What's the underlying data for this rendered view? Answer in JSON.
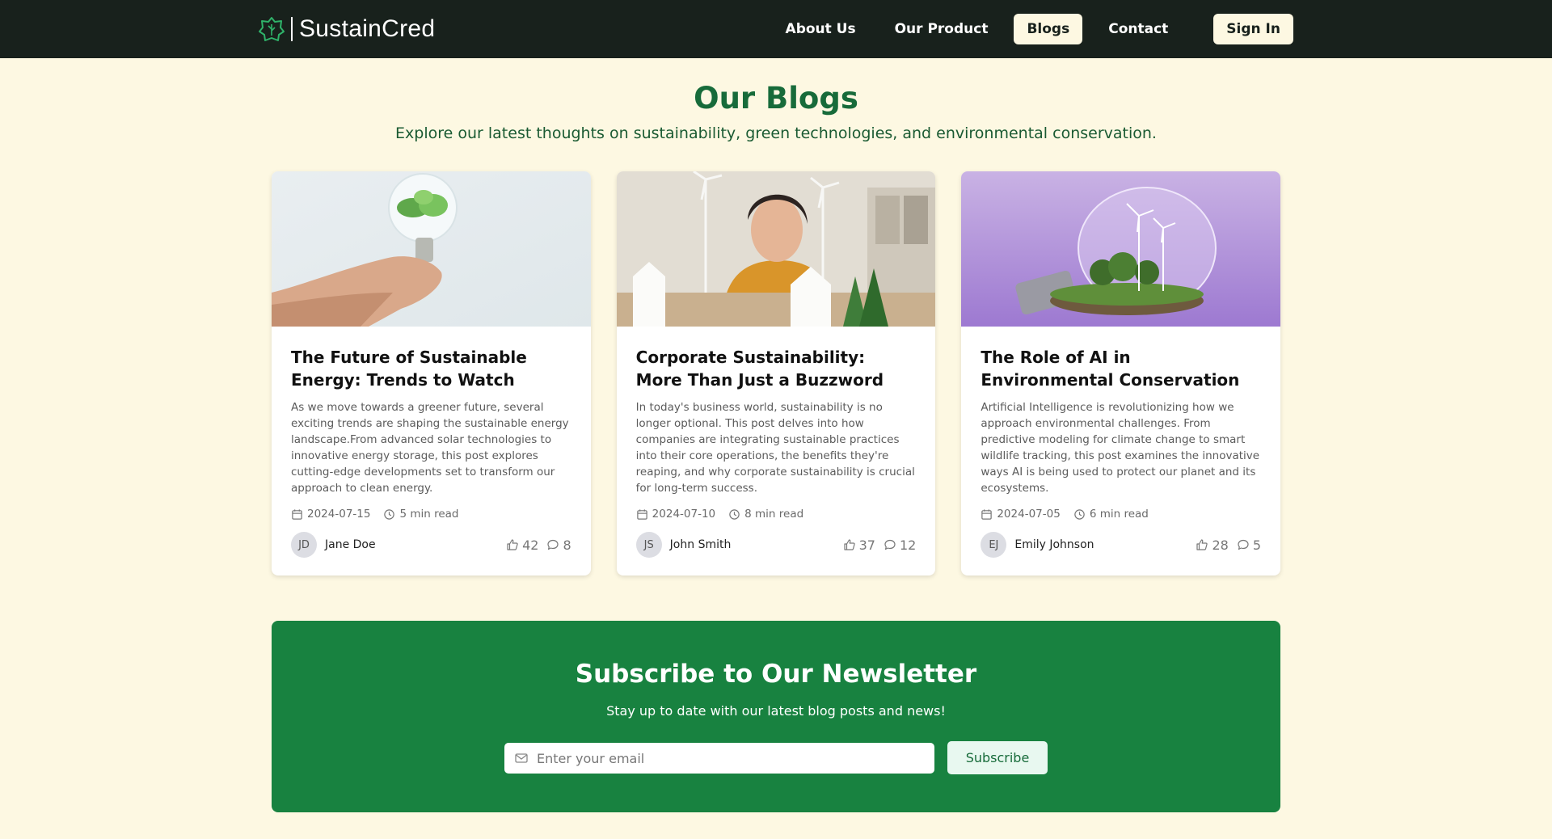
{
  "brand": {
    "name": "SustainCred",
    "icon": "leaf-shield-icon"
  },
  "nav": {
    "links": [
      "About Us",
      "Our Product",
      "Blogs",
      "Contact"
    ],
    "active": "Blogs",
    "signin_label": "Sign In"
  },
  "header": {
    "title": "Our Blogs",
    "subtitle": "Explore our latest thoughts on sustainability, green technologies, and environmental conservation."
  },
  "posts": [
    {
      "title": "The Future of Sustainable Energy: Trends to Watch",
      "excerpt": "As we move towards a greener future, several exciting trends are shaping the sustainable energy landscape.From advanced solar technologies to innovative energy storage, this post explores cutting-edge developments set to transform our approach to clean energy.",
      "date": "2024-07-15",
      "read_time": "5 min read",
      "author_initials": "JD",
      "author": "Jane Doe",
      "likes": "42",
      "comments": "8",
      "image": "hand-holding-plant-bulb"
    },
    {
      "title": "Corporate Sustainability: More Than Just a Buzzword",
      "excerpt": "In today's business world, sustainability is no longer optional. This post delves into how companies are integrating sustainable practices into their core operations, the benefits they're reaping, and why corporate sustainability is crucial for long-term success.",
      "date": "2024-07-10",
      "read_time": "8 min read",
      "author_initials": "JS",
      "author": "John Smith",
      "likes": "37",
      "comments": "12",
      "image": "woman-with-wind-turbine-models"
    },
    {
      "title": "The Role of AI in Environmental Conservation",
      "excerpt": "Artificial Intelligence is revolutionizing how we approach environmental challenges. From predictive modeling for climate change to smart wildlife tracking, this post examines the innovative ways AI is being used to protect our planet and its ecosystems.",
      "date": "2024-07-05",
      "read_time": "6 min read",
      "author_initials": "EJ",
      "author": "Emily Johnson",
      "likes": "28",
      "comments": "5",
      "image": "bulb-with-turbines-and-trees"
    }
  ],
  "newsletter": {
    "title": "Subscribe to Our Newsletter",
    "subtitle": "Stay up to date with our latest blog posts and news!",
    "email_placeholder": "Enter your email",
    "button_label": "Subscribe"
  },
  "colors": {
    "nav_bg": "#18211c",
    "page_bg": "#fdf8e2",
    "title_green": "#176b3a",
    "newsletter_bg": "#188240"
  }
}
